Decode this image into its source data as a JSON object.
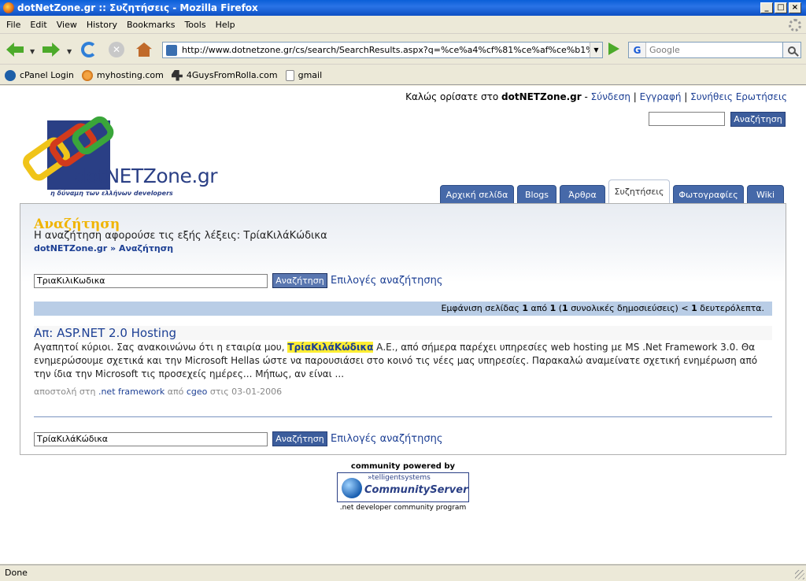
{
  "window": {
    "title": "dotNetZone.gr :: Συζητήσεις - Mozilla Firefox",
    "min": "_",
    "max": "□",
    "close": "×"
  },
  "menu": {
    "file": "File",
    "edit": "Edit",
    "view": "View",
    "history": "History",
    "bookmarks": "Bookmarks",
    "tools": "Tools",
    "help": "Help"
  },
  "nav": {
    "url": "http://www.dotnetzone.gr/cs/search/SearchResults.aspx?q=%ce%a4%cf%81%ce%af%ce%b1%ce%9",
    "search_engine": "G",
    "search_placeholder": "Google"
  },
  "bookmarks": [
    {
      "label": "cPanel Login",
      "icon": "cpanel-icon"
    },
    {
      "label": "myhosting.com",
      "icon": "myhosting-icon"
    },
    {
      "label": "4GuysFromRolla.com",
      "icon": "4guys-icon"
    },
    {
      "label": "gmail",
      "icon": "page-icon"
    }
  ],
  "header": {
    "welcome_prefix": "Καλώς ορίσατε στο ",
    "site_name": "dotNETZone.gr",
    "sep1": " - ",
    "login": "Σύνδεση",
    "sep2": " | ",
    "register": "Εγγραφή",
    "sep3": " | ",
    "faq": "Συνήθεις Ερωτήσεις",
    "search_button": "Αναζήτηση"
  },
  "logo": {
    "text": "dotNETZone.gr",
    "slogan": "η δύναμη των ελλήνων developers"
  },
  "tabs": [
    {
      "label": "Αρχική σελίδα",
      "active": false
    },
    {
      "label": "Blogs",
      "active": false
    },
    {
      "label": "Άρθρα",
      "active": false
    },
    {
      "label": "Συζητήσεις",
      "active": true
    },
    {
      "label": "Φωτογραφίες",
      "active": false
    },
    {
      "label": "Wiki",
      "active": false
    }
  ],
  "search_page": {
    "title": "Αναζήτηση",
    "subtitle": "Η αναζήτηση αφορούσε τις εξής λέξεις: ΤρίαΚιλάΚώδικα",
    "breadcrumb_root": "dotNETZone.gr",
    "breadcrumb_sep": " » ",
    "breadcrumb_current": "Αναζήτηση",
    "top_query": "ΤριαΚιλιΚωδικα",
    "bottom_query": "ΤρίαΚιλάΚώδικα",
    "search_button": "Αναζήτηση",
    "options_link": "Επιλογές αναζήτησης",
    "pager": {
      "prefix": "Εμφάνιση σελίδας ",
      "page": "1",
      "of": " από ",
      "total_pages": "1",
      "open": " (",
      "total_posts": "1",
      "posts_label": " συνολικές δημοσιεύσεις) < ",
      "seconds": "1",
      "seconds_label": " δευτερόλεπτα."
    }
  },
  "result": {
    "title": "Απ: ASP.NET 2.0 Hosting",
    "body_before": "Αγαπητοί κύριοι. Σας ανακοινώνω ότι η εταιρία μου, ",
    "highlight": "ΤρίαΚιλάΚώδικα",
    "body_after": " Α.Ε., από σήμερα παρέχει υπηρεσίες web hosting με MS .Net Framework 3.0. Θα ενημερώσουμε σχετικά και την Microsoft Hellas ώστε να παρουσιάσει στο κοινό τις νέες μας υπηρεσίες. Παρακαλώ αναμείνατε σχετική ενημέρωση από την ίδια την Microsoft τις προσεχείς ημέρες... Μήπως, αν είναι ...",
    "meta_posted": "αποστολή στη ",
    "forum": ".net framework",
    "meta_by": " από ",
    "author": "cgeo",
    "meta_on": " στις ",
    "date": "03-01-2006"
  },
  "footer": {
    "powered": "community powered by",
    "ts": "»telligentsystems",
    "cs": "CommunityServer",
    "program": ".net developer community program"
  },
  "status": {
    "text": "Done"
  }
}
